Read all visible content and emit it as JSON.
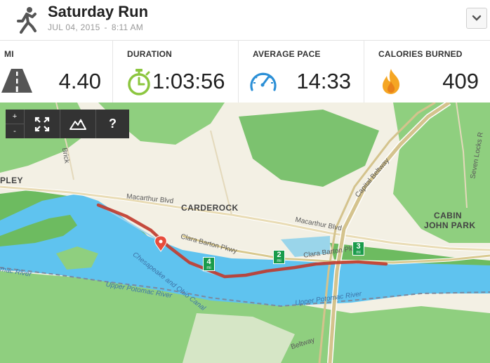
{
  "header": {
    "title": "Saturday Run",
    "date": "JUL 04, 2015",
    "separator": "-",
    "time": "8:11 AM"
  },
  "stats": [
    {
      "label": "MI",
      "value": "4.40",
      "icon": "road-icon"
    },
    {
      "label": "DURATION",
      "value": "1:03:56",
      "icon": "stopwatch-icon"
    },
    {
      "label": "AVERAGE PACE",
      "value": "14:33",
      "icon": "speedometer-icon"
    },
    {
      "label": "CALORIES BURNED",
      "value": "409",
      "icon": "flame-icon"
    }
  ],
  "map": {
    "controls": {
      "zoom_in": "+",
      "zoom_out": "-",
      "help": "?"
    },
    "labels": {
      "carderock": "CARDEROCK",
      "cabin": "CABIN",
      "john_park": "JOHN PARK",
      "pley": "PLEY",
      "macarthur_w": "Macarthur Blvd",
      "macarthur_e": "Macarthur Blvd",
      "clara_barton_w": "Clara Barton Pkwy",
      "clara_barton_e": "Clara Barton Pk",
      "canal": "Chesapeake and Ohio Canal",
      "upper_potomac": "Upper Potomac River",
      "upper_potomac_2": "Upper Potomac River",
      "potomac_west": "mac River",
      "capital_beltway": "Capital Beltway",
      "beltway_south": "Beltway",
      "brick": "Brick",
      "seven_locks": "Seven Locks R"
    },
    "mile_markers": [
      {
        "num": "2",
        "unit": "mi"
      },
      {
        "num": "3",
        "unit": "mi"
      },
      {
        "num": "4",
        "unit": "mi"
      }
    ],
    "colors": {
      "route": "#c0392b",
      "water": "#5fc3ef",
      "forest": "#7cc26f",
      "land": "#f3f0e4",
      "marker": "#1a9b4b"
    }
  }
}
